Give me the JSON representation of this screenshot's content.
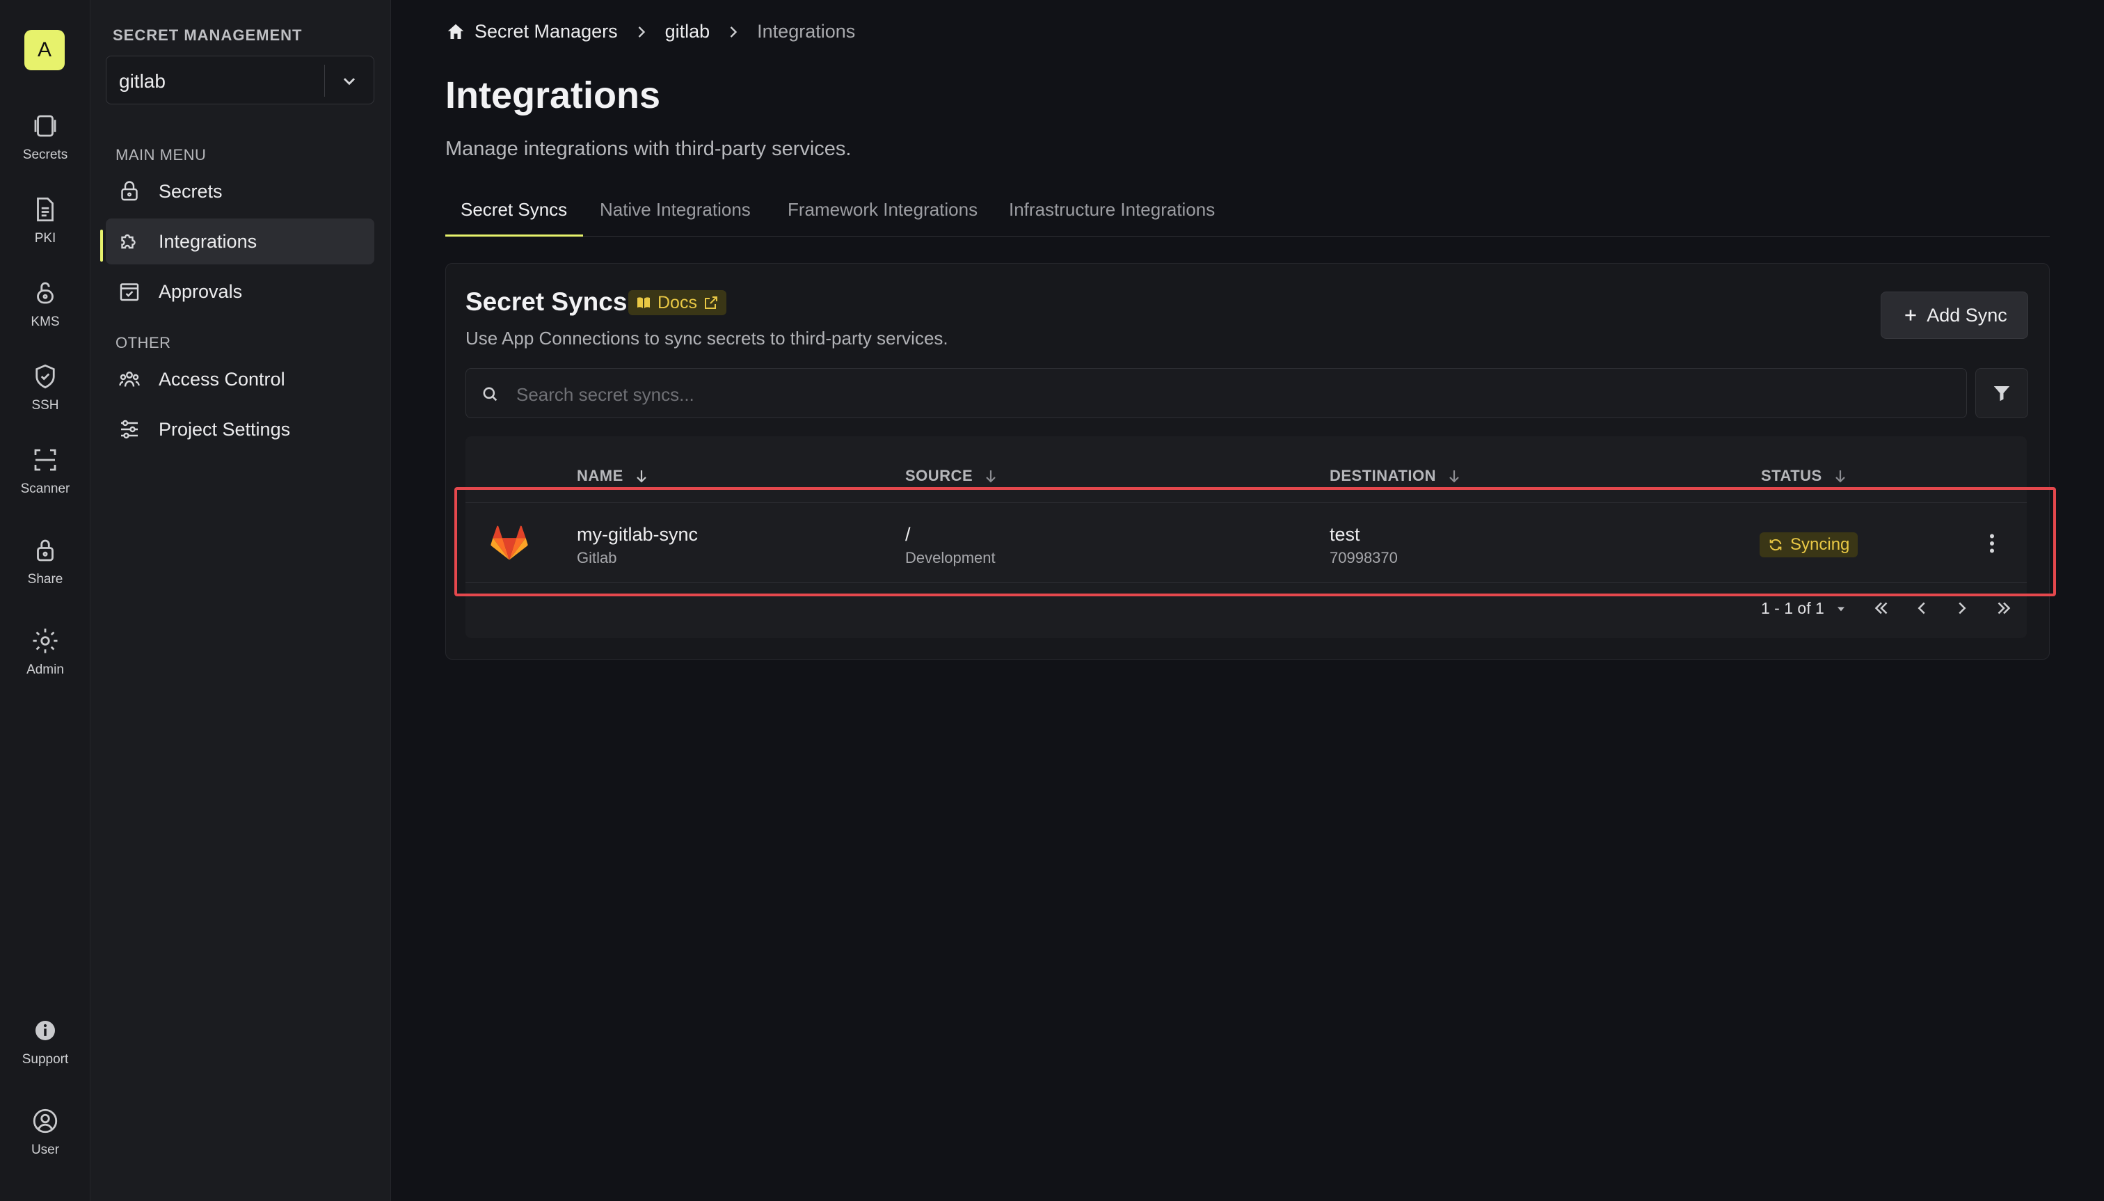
{
  "rail": {
    "avatar": "A",
    "items": [
      {
        "label": "Secrets",
        "icon": "secrets-icon"
      },
      {
        "label": "PKI",
        "icon": "document-icon"
      },
      {
        "label": "KMS",
        "icon": "lock-open-icon"
      },
      {
        "label": "SSH",
        "icon": "shield-icon"
      },
      {
        "label": "Scanner",
        "icon": "scan-icon"
      },
      {
        "label": "Share",
        "icon": "lock-icon"
      },
      {
        "label": "Admin",
        "icon": "gear-icon"
      },
      {
        "label": "Support",
        "icon": "info-icon"
      },
      {
        "label": "User",
        "icon": "user-icon"
      }
    ]
  },
  "sidebar": {
    "heading": "SECRET MANAGEMENT",
    "project": "gitlab",
    "main_menu_label": "MAIN MENU",
    "other_label": "OTHER",
    "items": [
      {
        "label": "Secrets",
        "icon": "lock-icon"
      },
      {
        "label": "Integrations",
        "icon": "puzzle-icon",
        "active": true
      },
      {
        "label": "Approvals",
        "icon": "calendar-check-icon"
      },
      {
        "label": "Access Control",
        "icon": "users-icon"
      },
      {
        "label": "Project Settings",
        "icon": "sliders-icon"
      }
    ]
  },
  "breadcrumb": {
    "items": [
      "Secret Managers",
      "gitlab",
      "Integrations"
    ]
  },
  "page": {
    "title": "Integrations",
    "subtitle": "Manage integrations with third-party services."
  },
  "tabs": [
    {
      "label": "Secret Syncs",
      "active": true
    },
    {
      "label": "Native Integrations"
    },
    {
      "label": "Framework Integrations"
    },
    {
      "label": "Infrastructure Integrations"
    }
  ],
  "card": {
    "title": "Secret Syncs",
    "docs_label": "Docs",
    "subtitle": "Use App Connections to sync secrets to third-party services.",
    "add_label": "Add Sync",
    "search_placeholder": "Search secret syncs..."
  },
  "table": {
    "columns": [
      "NAME",
      "SOURCE",
      "DESTINATION",
      "STATUS"
    ],
    "rows": [
      {
        "name": "my-gitlab-sync",
        "provider": "Gitlab",
        "source_path": "/",
        "source_env": "Development",
        "destination": "test",
        "destination_id": "70998370",
        "status": "Syncing"
      }
    ],
    "pagination": "1 - 1 of 1"
  },
  "colors": {
    "accent": "#e7f26c",
    "status_text": "#e9c845",
    "highlight": "#e5484d",
    "background": "#111217"
  }
}
